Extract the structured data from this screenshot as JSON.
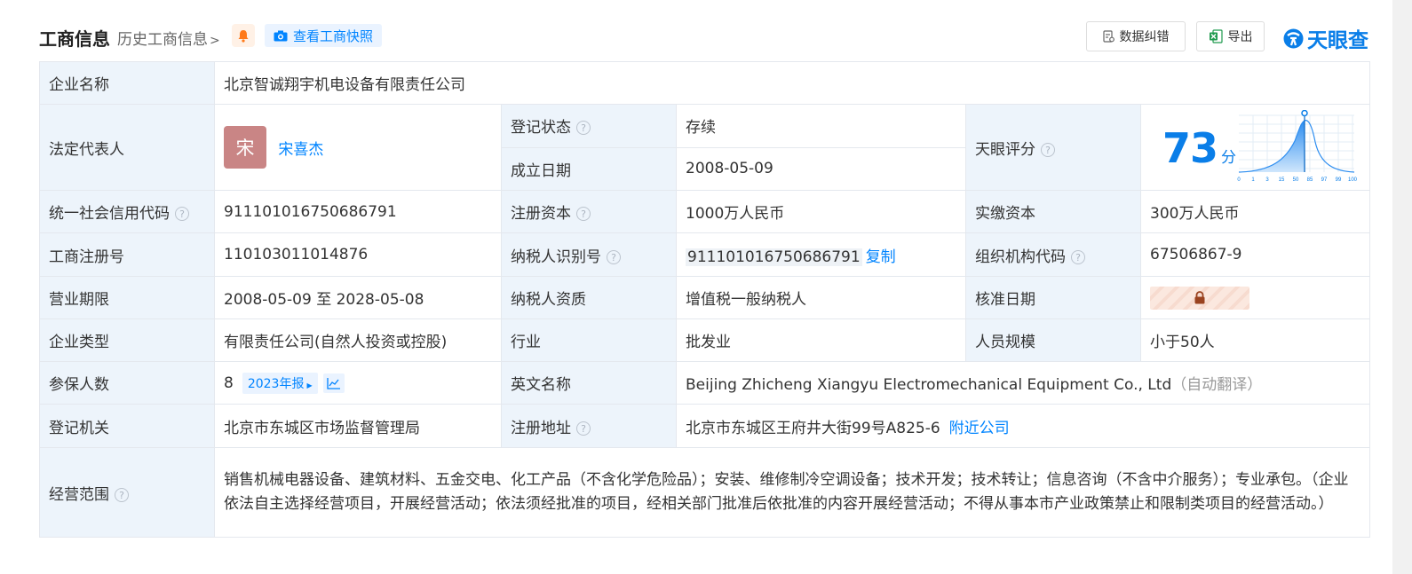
{
  "header": {
    "title": "工商信息",
    "history_link": "历史工商信息",
    "history_chevron": ">",
    "snapshot_button": "查看工商快照",
    "error_button": "数据纠错",
    "export_button": "导出",
    "logo_text": "天眼查"
  },
  "company": {
    "name_label": "企业名称",
    "name": "北京智诚翔宇机电设备有限责任公司",
    "legal_rep_label": "法定代表人",
    "legal_rep_avatar": "宋",
    "legal_rep": "宋喜杰",
    "reg_status_label": "登记状态",
    "reg_status": "存续",
    "founded_label": "成立日期",
    "founded": "2008-05-09",
    "score_label": "天眼评分",
    "score": "73",
    "score_unit": "分",
    "score_axis": [
      "0",
      "1",
      "3",
      "15",
      "50",
      "85",
      "97",
      "99",
      "100"
    ],
    "credit_code_label": "统一社会信用代码",
    "credit_code": "911101016750686791",
    "reg_capital_label": "注册资本",
    "reg_capital": "1000万人民币",
    "paid_capital_label": "实缴资本",
    "paid_capital": "300万人民币",
    "reg_no_label": "工商注册号",
    "reg_no": "110103011014876",
    "taxpayer_id_label": "纳税人识别号",
    "taxpayer_id": "911101016750686791",
    "copy_label": "复制",
    "org_code_label": "组织机构代码",
    "org_code": "67506867-9",
    "term_label": "营业期限",
    "term": "2008-05-09 至 2028-05-08",
    "taxpayer_qual_label": "纳税人资质",
    "taxpayer_qual": "增值税一般纳税人",
    "approval_date_label": "核准日期",
    "type_label": "企业类型",
    "type": "有限责任公司(自然人投资或控股)",
    "industry_label": "行业",
    "industry": "批发业",
    "staff_label": "人员规模",
    "staff": "小于50人",
    "insured_label": "参保人数",
    "insured": "8",
    "annual_report_tag": "2023年报",
    "english_name_label": "英文名称",
    "english_name": "Beijing Zhicheng Xiangyu Electromechanical Equipment Co., Ltd",
    "auto_translate": "（自动翻译）",
    "authority_label": "登记机关",
    "authority": "北京市东城区市场监督管理局",
    "address_label": "注册地址",
    "address": "北京市东城区王府井大街99号A825-6",
    "nearby_link": "附近公司",
    "scope_label": "经营范围",
    "scope": "销售机械电器设备、建筑材料、五金交电、化工产品（不含化学危险品）；安装、维修制冷空调设备；技术开发；技术转让；信息咨询（不含中介服务）；专业承包。（企业依法自主选择经营项目，开展经营活动；依法须经批准的项目，经相关部门批准后依批准的内容开展经营活动；不得从事本市产业政策禁止和限制类项目的经营活动。）"
  },
  "colors": {
    "accent": "#0084ff",
    "label_bg": "#edf4fb",
    "status_green": "#26a347",
    "avatar_bg": "#c98585"
  }
}
